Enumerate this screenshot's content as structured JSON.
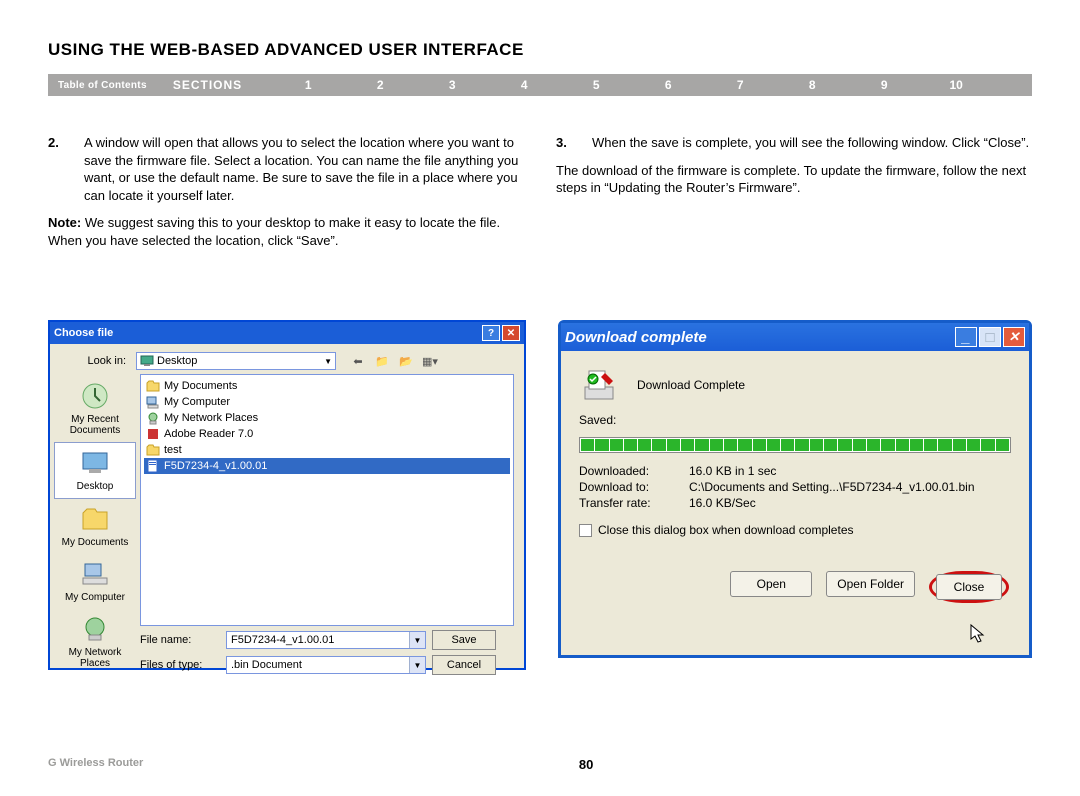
{
  "page": {
    "title": "USING THE WEB-BASED ADVANCED USER INTERFACE",
    "footer_product": "G Wireless Router",
    "page_number": "80"
  },
  "nav": {
    "toc": "Table of Contents",
    "sections_label": "SECTIONS",
    "items": [
      "1",
      "2",
      "3",
      "4",
      "5",
      "6",
      "7",
      "8",
      "9",
      "10"
    ],
    "active_index": 5
  },
  "left_col": {
    "step_num": "2.",
    "step_text": "A window will open that allows you to select the location where you want to save the firmware file. Select a location. You can name the file anything you want, or use the default name. Be sure to save the file in a place where you can locate it yourself later.",
    "note_label": "Note:",
    "note_text": " We suggest saving this to your desktop to make it easy to locate the file. When you have selected the location, click “Save”."
  },
  "right_col": {
    "step_num": "3.",
    "step_text": "When the save is complete, you will see the following window. Click “Close”.",
    "para2": "The download of the firmware is complete. To update the firmware, follow the next steps in “Updating the Router’s Firmware”."
  },
  "choose_file": {
    "title": "Choose file",
    "lookin_label": "Look in:",
    "lookin_value": "Desktop",
    "places": [
      "My Recent Documents",
      "Desktop",
      "My Documents",
      "My Computer",
      "My Network Places"
    ],
    "selected_place_index": 1,
    "files": [
      {
        "name": "My Documents",
        "type": "folder"
      },
      {
        "name": "My Computer",
        "type": "computer"
      },
      {
        "name": "My Network Places",
        "type": "network"
      },
      {
        "name": "Adobe Reader 7.0",
        "type": "app"
      },
      {
        "name": "test",
        "type": "folder"
      },
      {
        "name": "F5D7234-4_v1.00.01",
        "type": "file",
        "selected": true
      }
    ],
    "file_name_label": "File name:",
    "file_name_value": "F5D7234-4_v1.00.01",
    "file_type_label": "Files of type:",
    "file_type_value": ".bin Document",
    "save_btn": "Save",
    "cancel_btn": "Cancel"
  },
  "download_complete": {
    "title": "Download complete",
    "status": "Download Complete",
    "saved_label": "Saved:",
    "downloaded_label": "Downloaded:",
    "downloaded_value": "16.0 KB in 1 sec",
    "download_to_label": "Download to:",
    "download_to_value": "C:\\Documents and Setting...\\F5D7234-4_v1.00.01.bin",
    "rate_label": "Transfer rate:",
    "rate_value": "16.0 KB/Sec",
    "checkbox_label": "Close this dialog box when download completes",
    "open_btn": "Open",
    "open_folder_btn": "Open Folder",
    "close_btn": "Close"
  }
}
